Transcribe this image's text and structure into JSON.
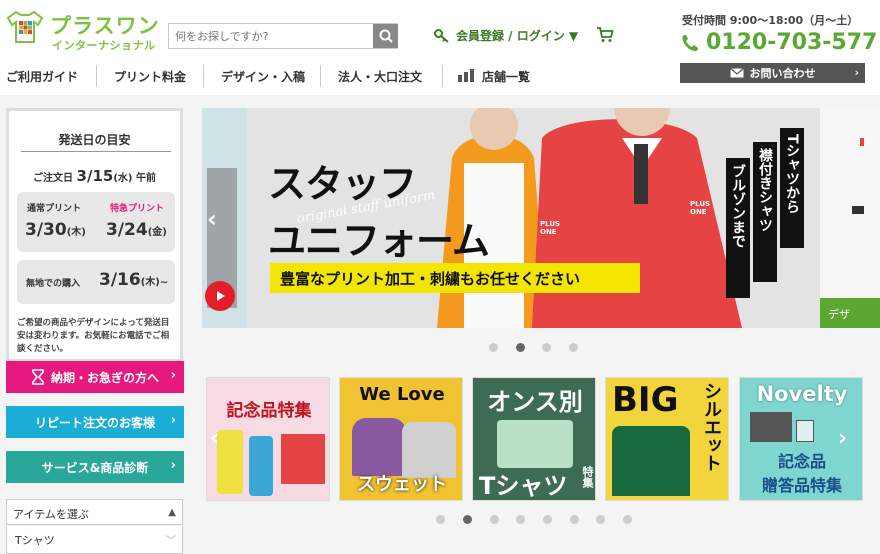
{
  "header": {
    "logo_title": "プラスワン",
    "logo_sub": "インターナショナル",
    "search_placeholder": "何をお探しですか?",
    "member_link": "会員登録 / ログイン ▼",
    "hours": "受付時間 9:00～18:00（月～土）",
    "phone": "0120-703-577",
    "contact_label": "お問い合わせ"
  },
  "nav": {
    "items": [
      "ご利用ガイド",
      "プリント料金",
      "デザイン・入稿",
      "法人・大口注文",
      "店舗一覧"
    ]
  },
  "shipping": {
    "title": "発送日の目安",
    "order_prefix": "ご注文日",
    "order_date": "3/15",
    "order_dow": "(水)",
    "order_suffix": "午前",
    "normal_label": "通常プリント",
    "normal_date": "3/30",
    "normal_dow": "(木)",
    "express_label": "特急プリント",
    "express_date": "3/24",
    "express_dow": "(金)",
    "plain_label": "無地での購入",
    "plain_date": "3/16",
    "plain_dow": "(木)~",
    "note": "ご希望の商品やデザインによって発送目安は変わります。お気軽にお電話でご相談ください。"
  },
  "side_buttons": [
    {
      "label": "納期・お急ぎの方へ",
      "color": "#e6197e"
    },
    {
      "label": "リピート注文のお客様",
      "color": "#1aaed6"
    },
    {
      "label": "サービス&商品診断",
      "color": "#2aa79b"
    }
  ],
  "item_select": {
    "label": "アイテムを選ぶ",
    "first": "Tシャツ"
  },
  "hero": {
    "title_line1": "スタッフ",
    "title_line2": "ユニフォーム",
    "script": "original staff uniform",
    "banner": "豊富なプリント加工・刺繍もお任せください",
    "vertical": [
      "Tシャツから",
      "襟付きシャツ",
      "ブルゾンまで"
    ],
    "peek_text": "デザ"
  },
  "thumbs": [
    {
      "title": "記念品特集",
      "bg": "#f6dbe2"
    },
    {
      "title": "We Love",
      "sub": "スウェット",
      "bg": "#f1c232"
    },
    {
      "title": "オンス別",
      "sub": "Tシャツ",
      "sub2": "特集",
      "bg": "#3e6b53"
    },
    {
      "title": "BIG",
      "sub": "シルエット",
      "bg": "#f2d53c"
    },
    {
      "title": "Novelty",
      "sub": "記念品",
      "sub2": "贈答品特集",
      "bg": "#7fd5cf"
    }
  ],
  "colors": {
    "brand_green": "#7cc242",
    "hero_red": "#e64444",
    "hero_orange": "#f39a1f"
  }
}
